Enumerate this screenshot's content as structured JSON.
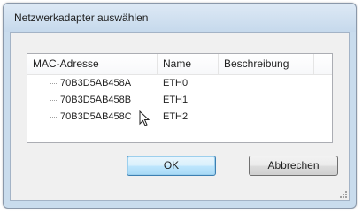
{
  "window": {
    "title": "Netzwerkadapter auswählen"
  },
  "table": {
    "columns": [
      "MAC-Adresse",
      "Name",
      "Beschreibung"
    ],
    "rows": [
      {
        "mac": "70B3D5AB458A",
        "name": "ETH0",
        "description": ""
      },
      {
        "mac": "70B3D5AB458B",
        "name": "ETH1",
        "description": ""
      },
      {
        "mac": "70B3D5AB458C",
        "name": "ETH2",
        "description": ""
      }
    ]
  },
  "buttons": {
    "ok_label": "OK",
    "cancel_label": "Abbrechen"
  },
  "colors": {
    "window_frame": "#c9dced",
    "client_bg": "#f0f0f0",
    "default_button_border": "#3c7fb1"
  },
  "icons": [
    "mouse-pointer-icon",
    "resize-grip-icon"
  ]
}
